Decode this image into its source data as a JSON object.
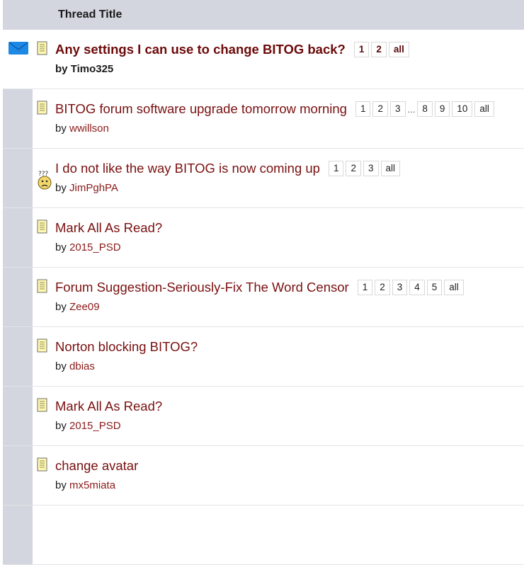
{
  "header": {
    "title": "Thread Title"
  },
  "threads": [
    {
      "title": "Any settings I can use to change BITOG back?",
      "by_prefix": "by",
      "author": "Timo325",
      "pages": [
        "1",
        "2",
        "all"
      ],
      "unread": true,
      "icon": "document-icon"
    },
    {
      "title": "BITOG forum software upgrade tomorrow morning",
      "by_prefix": "by",
      "author": "wwillson",
      "pages": [
        "1",
        "2",
        "3",
        "...",
        "8",
        "9",
        "10",
        "all"
      ],
      "icon": "document-icon"
    },
    {
      "title": "I do not like the way BITOG is now coming up",
      "by_prefix": "by",
      "author": "JimPghPA",
      "pages": [
        "1",
        "2",
        "3",
        "all"
      ],
      "icon": "confused-face-icon"
    },
    {
      "title": "Mark All As Read?",
      "by_prefix": "by",
      "author": "2015_PSD",
      "pages": [],
      "icon": "document-icon"
    },
    {
      "title": "Forum Suggestion-Seriously-Fix The Word Censor",
      "by_prefix": "by",
      "author": "Zee09",
      "pages": [
        "1",
        "2",
        "3",
        "4",
        "5",
        "all"
      ],
      "icon": "document-icon"
    },
    {
      "title": "Norton blocking BITOG?",
      "by_prefix": "by",
      "author": "dbias",
      "pages": [],
      "icon": "document-icon"
    },
    {
      "title": "Mark All As Read?",
      "by_prefix": "by",
      "author": "2015_PSD",
      "pages": [],
      "icon": "document-icon"
    },
    {
      "title": "change avatar",
      "by_prefix": "by",
      "author": "mx5miata",
      "pages": [],
      "icon": "document-icon"
    }
  ],
  "colors": {
    "gutter": "#d3d6de",
    "title_link": "#7a1010",
    "mail_icon": "#1e88e5"
  }
}
